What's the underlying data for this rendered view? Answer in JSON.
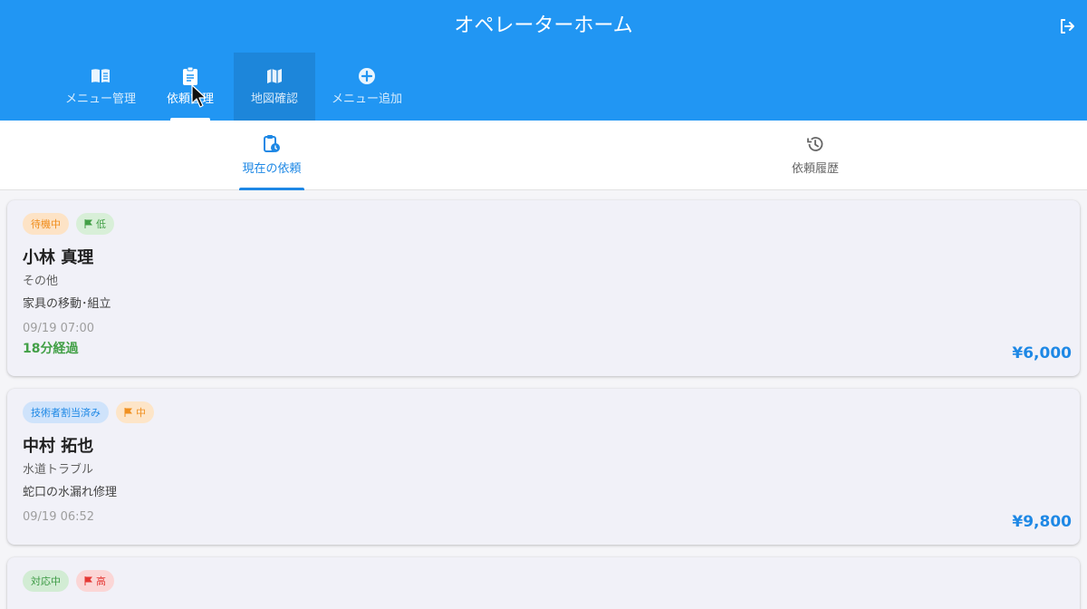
{
  "app": {
    "title": "オペレーターホーム"
  },
  "nav": {
    "items": [
      {
        "label": "メニュー管理",
        "icon": "menu-book-icon"
      },
      {
        "label": "依頼管理",
        "icon": "assignment-icon"
      },
      {
        "label": "地図確認",
        "icon": "map-icon"
      },
      {
        "label": "メニュー追加",
        "icon": "add-circle-icon"
      }
    ],
    "active": "依頼管理"
  },
  "tabs": {
    "current": "現在の依頼",
    "history": "依頼履歴"
  },
  "requests": [
    {
      "status": "待機中",
      "priority": "低",
      "name": "小林 真理",
      "category": "その他",
      "description": "家具の移動･組立",
      "datetime": "09/19 07:00",
      "elapsed": "18分経過",
      "price": "¥6,000"
    },
    {
      "status": "技術者割当済み",
      "priority": "中",
      "name": "中村 拓也",
      "category": "水道トラブル",
      "description": "蛇口の水漏れ修理",
      "datetime": "09/19 06:52",
      "price": "¥9,800"
    },
    {
      "status": "対応中",
      "priority": "高"
    }
  ],
  "colors": {
    "primary": "#2196f3",
    "accent": "#1e88e5",
    "waiting": "#f08c1a",
    "low": "#43a047",
    "high": "#e53935"
  }
}
